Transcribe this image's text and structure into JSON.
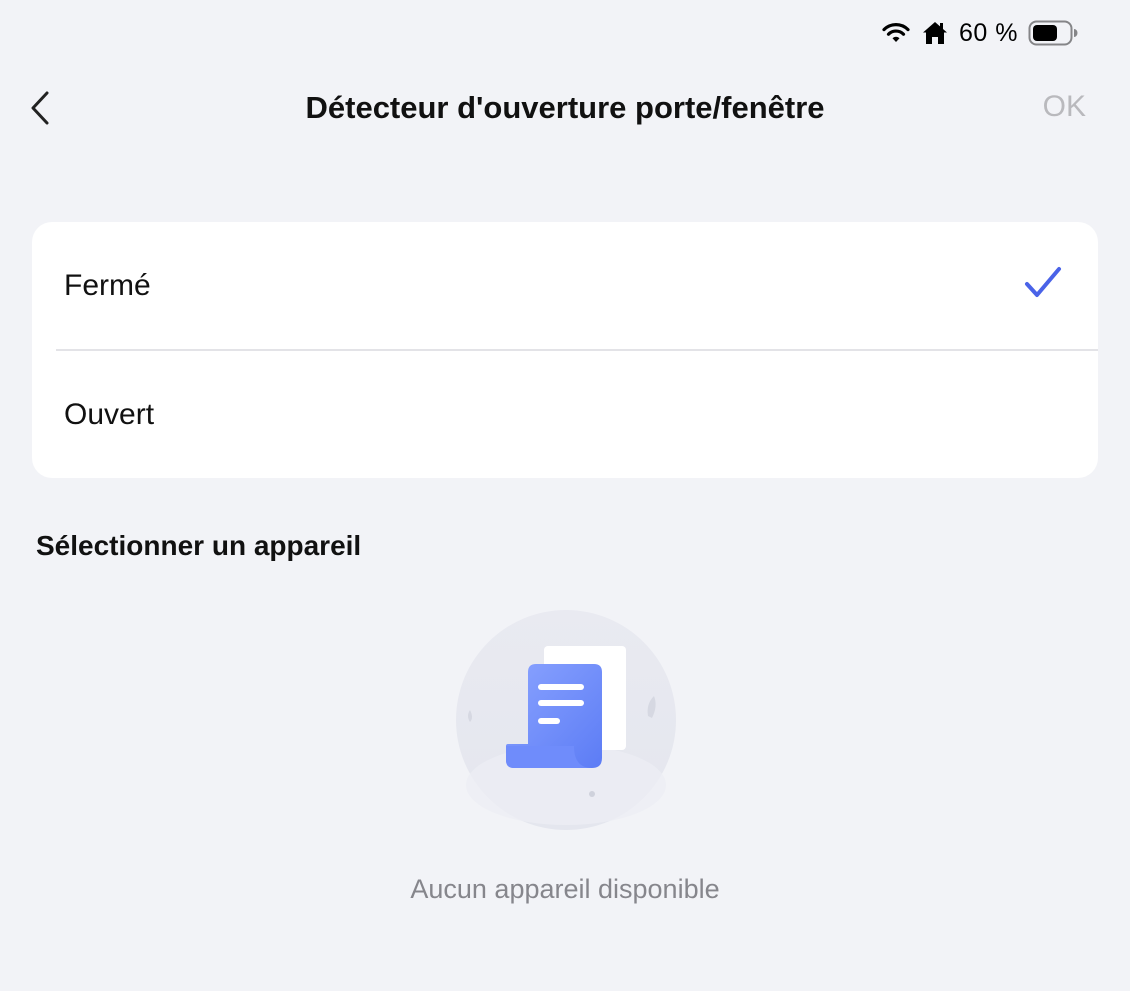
{
  "status_bar": {
    "battery_text": "60 %",
    "icons": [
      "wifi-icon",
      "home-icon",
      "battery-icon"
    ]
  },
  "nav": {
    "title": "Détecteur d'ouverture porte/fenêtre",
    "ok_label": "OK",
    "back_icon": "chevron-left-icon"
  },
  "options": [
    {
      "label": "Fermé",
      "selected": true
    },
    {
      "label": "Ouvert",
      "selected": false
    }
  ],
  "section": {
    "title": "Sélectionner un appareil"
  },
  "empty_state": {
    "text": "Aucun appareil disponible",
    "icon": "empty-document-illustration"
  },
  "colors": {
    "background": "#f2f3f7",
    "accent": "#4a63e8",
    "ok_disabled": "#b9b9bd",
    "muted_text": "#86868c"
  }
}
